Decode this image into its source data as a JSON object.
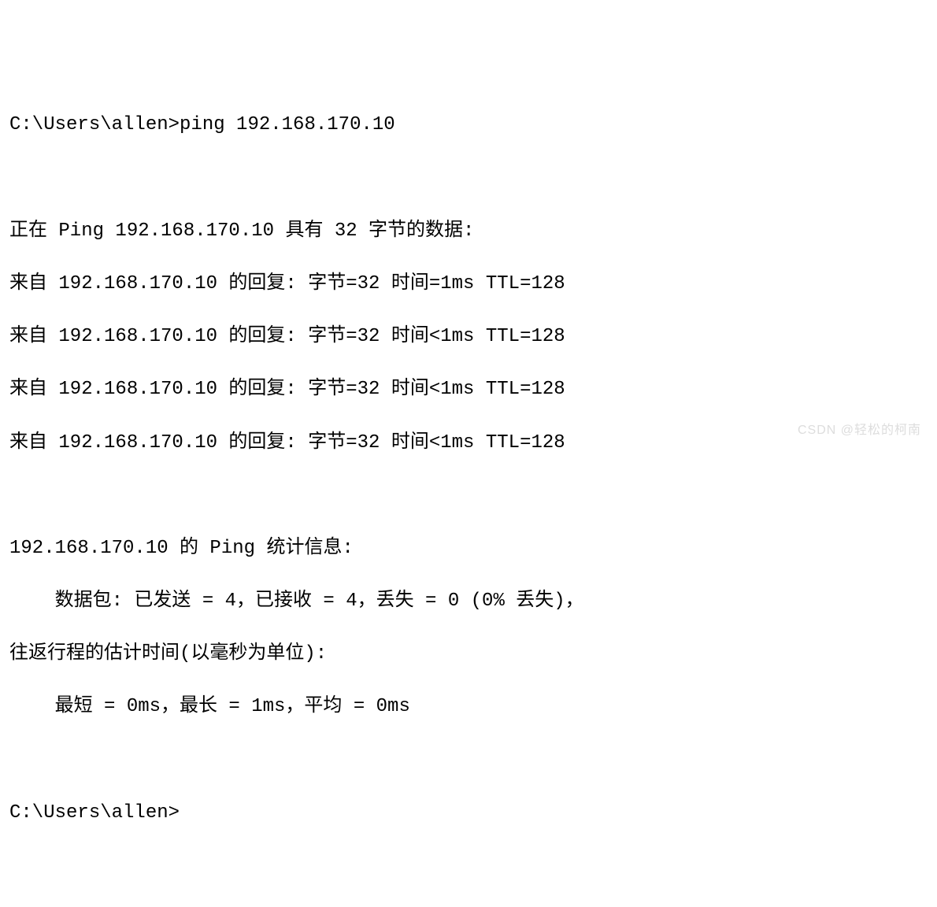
{
  "prompt1": "C:\\Users\\allen>ping 192.168.170.10",
  "blank1": "",
  "header": "正在 Ping 192.168.170.10 具有 32 字节的数据:",
  "reply1": "来自 192.168.170.10 的回复: 字节=32 时间=1ms TTL=128",
  "reply2": "来自 192.168.170.10 的回复: 字节=32 时间<1ms TTL=128",
  "reply3": "来自 192.168.170.10 的回复: 字节=32 时间<1ms TTL=128",
  "reply4": "来自 192.168.170.10 的回复: 字节=32 时间<1ms TTL=128",
  "blank2": "",
  "stats_header": "192.168.170.10 的 Ping 统计信息:",
  "packets": "    数据包: 已发送 = 4，已接收 = 4，丢失 = 0 (0% 丢失)，",
  "rtt_header": "往返行程的估计时间(以毫秒为单位):",
  "rtt_values": "    最短 = 0ms，最长 = 1ms，平均 = 0ms",
  "blank3": "",
  "prompt2": "C:\\Users\\allen>",
  "watermark": "CSDN @轻松的柯南"
}
